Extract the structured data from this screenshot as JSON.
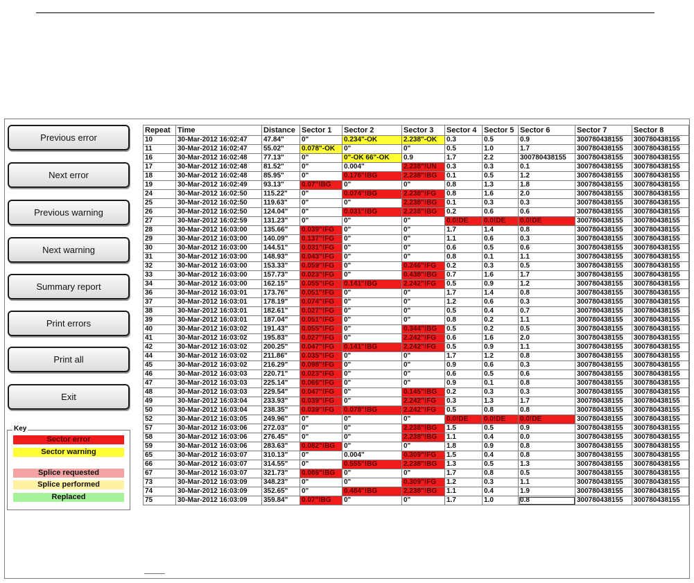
{
  "buttons": [
    {
      "label": "Previous error"
    },
    {
      "label": "Next error"
    },
    {
      "label": "Previous warning"
    },
    {
      "label": "Next warning"
    },
    {
      "label": "Summary report"
    },
    {
      "label": "Print errors"
    },
    {
      "label": "Print all"
    },
    {
      "label": "Exit"
    }
  ],
  "key": {
    "title": "Key",
    "items": [
      {
        "label": "Sector error",
        "color": "#ee1c1c"
      },
      {
        "label": "Sector warning",
        "color": "#ffff33"
      },
      {
        "label": "Splice requested",
        "color": "#f4a3a3"
      },
      {
        "label": "Splice performed",
        "color": "#fff2a3"
      },
      {
        "label": "Replaced",
        "color": "#a6f29a"
      }
    ]
  },
  "table": {
    "headers": [
      "Repeat",
      "Time",
      "Distance",
      "Sector 1",
      "Sector 2",
      "Sector 3",
      "Sector 4",
      "Sector 5",
      "Sector 6",
      "Sector 7",
      "Sector 8"
    ],
    "rows": [
      [
        "10",
        "30-Mar-2012 16:02:47",
        "47.84\"",
        "0\"",
        "0.234\"-OK",
        "2.238\"-OK",
        "0.3",
        "0.5",
        "0.9",
        "300780438155",
        "300780438155"
      ],
      [
        "11",
        "30-Mar-2012 16:02:47",
        "55.02\"",
        "0.078\"-OK",
        "0\"",
        "0\"",
        "0.5",
        "1.0",
        "1.7",
        "300780438155",
        "300780438155"
      ],
      [
        "16",
        "30-Mar-2012 16:02:48",
        "77.13\"",
        "0\"",
        "0\"-OK 66\"-OK",
        "0.9",
        "1.7",
        "2.2",
        "300780438155",
        "300780438155",
        "300780438155"
      ],
      [
        "17",
        "30-Mar-2012 16:02:48",
        "81.52\"",
        "0\"",
        "0.004\"",
        "2.238\"!UN",
        "0.3",
        "0.3",
        "0.1",
        "300780438155",
        "300780438155"
      ],
      [
        "18",
        "30-Mar-2012 16:02:48",
        "85.95\"",
        "0\"",
        "0.176\"!BG",
        "2.238\"!BG",
        "0.1",
        "0.5",
        "1.2",
        "300780438155",
        "300780438155"
      ],
      [
        "19",
        "30-Mar-2012 16:02:49",
        "93.13\"",
        "0.07\"!BG",
        "0\"",
        "0\"",
        "0.8",
        "1.3",
        "1.8",
        "300780438155",
        "300780438155"
      ],
      [
        "24",
        "30-Mar-2012 16:02:50",
        "115.22\"",
        "0\"",
        "0.074\"!BG",
        "2.238\"!FG",
        "0.8",
        "1.6",
        "2.0",
        "300780438155",
        "300780438155"
      ],
      [
        "25",
        "30-Mar-2012 16:02:50",
        "119.63\"",
        "0\"",
        "0\"",
        "2.238\"!BG",
        "0.1",
        "0.3",
        "0.3",
        "300780438155",
        "300780438155"
      ],
      [
        "26",
        "30-Mar-2012 16:02:50",
        "124.04\"",
        "0\"",
        "0.031\"!BG",
        "2.238\"!BG",
        "0.2",
        "0.6",
        "0.6",
        "300780438155",
        "300780438155"
      ],
      [
        "27",
        "30-Mar-2012 16:02:59",
        "131.23\"",
        "0\"",
        "0\"",
        "0\"",
        "0.0!DE",
        "0.0!DE",
        "0.0!DE",
        "300780438155",
        "300780438155"
      ],
      [
        "28",
        "30-Mar-2012 16:03:00",
        "135.66\"",
        "0.039\"!FG",
        "0\"",
        "0\"",
        "1.7",
        "1.4",
        "0.8",
        "300780438155",
        "300780438155"
      ],
      [
        "29",
        "30-Mar-2012 16:03:00",
        "140.09\"",
        "0.137\"!FG",
        "0\"",
        "0\"",
        "1.1",
        "0.6",
        "0.3",
        "300780438155",
        "300780438155"
      ],
      [
        "30",
        "30-Mar-2012 16:03:00",
        "144.51\"",
        "0.031\"!FG",
        "0\"",
        "0\"",
        "0.6",
        "0.5",
        "0.6",
        "300780438155",
        "300780438155"
      ],
      [
        "31",
        "30-Mar-2012 16:03:00",
        "148.93\"",
        "0.043\"!FG",
        "0\"",
        "0\"",
        "0.8",
        "0.1",
        "1.1",
        "300780438155",
        "300780438155"
      ],
      [
        "32",
        "30-Mar-2012 16:03:00",
        "153.33\"",
        "0.059\"!FG",
        "0\"",
        "0.246\"!FG",
        "0.2",
        "0.3",
        "0.5",
        "300780438155",
        "300780438155"
      ],
      [
        "33",
        "30-Mar-2012 16:03:00",
        "157.73\"",
        "0.023\"!FG",
        "0\"",
        "0.438\"!BG",
        "0.7",
        "1.6",
        "1.7",
        "300780438155",
        "300780438155"
      ],
      [
        "34",
        "30-Mar-2012 16:03:00",
        "162.15\"",
        "0.055\"!FG",
        "0.141\"!BG",
        "2.242\"!FG",
        "0.5",
        "0.9",
        "1.2",
        "300780438155",
        "300780438155"
      ],
      [
        "36",
        "30-Mar-2012 16:03:01",
        "173.76\"",
        "0.051\"!FG",
        "0\"",
        "0\"",
        "1.7",
        "1.4",
        "0.8",
        "300780438155",
        "300780438155"
      ],
      [
        "37",
        "30-Mar-2012 16:03:01",
        "178.19\"",
        "0.074\"!FG",
        "0\"",
        "0\"",
        "1.2",
        "0.6",
        "0.3",
        "300780438155",
        "300780438155"
      ],
      [
        "38",
        "30-Mar-2012 16:03:01",
        "182.61\"",
        "0.027\"!FG",
        "0\"",
        "0\"",
        "0.5",
        "0.4",
        "0.7",
        "300780438155",
        "300780438155"
      ],
      [
        "39",
        "30-Mar-2012 16:03:01",
        "187.04\"",
        "0.051\"!FG",
        "0\"",
        "0\"",
        "0.8",
        "0.2",
        "1.1",
        "300780438155",
        "300780438155"
      ],
      [
        "40",
        "30-Mar-2012 16:03:02",
        "191.43\"",
        "0.055\"!FG",
        "0\"",
        "0.344\"!BG",
        "0.5",
        "0.2",
        "0.5",
        "300780438155",
        "300780438155"
      ],
      [
        "41",
        "30-Mar-2012 16:03:02",
        "195.83\"",
        "0.027\"!FG",
        "0\"",
        "2.242\"!FG",
        "0.6",
        "1.6",
        "2.0",
        "300780438155",
        "300780438155"
      ],
      [
        "42",
        "30-Mar-2012 16:03:02",
        "200.25\"",
        "0.047\"!FG",
        "0.141\"!BG",
        "2.242\"!FG",
        "0.5",
        "0.9",
        "1.1",
        "300780438155",
        "300780438155"
      ],
      [
        "44",
        "30-Mar-2012 16:03:02",
        "211.86\"",
        "0.035\"!FG",
        "0\"",
        "0\"",
        "1.7",
        "1.2",
        "0.8",
        "300780438155",
        "300780438155"
      ],
      [
        "45",
        "30-Mar-2012 16:03:02",
        "216.29\"",
        "0.098\"!FG",
        "0\"",
        "0\"",
        "0.9",
        "0.6",
        "0.3",
        "300780438155",
        "300780438155"
      ],
      [
        "46",
        "30-Mar-2012 16:03:03",
        "220.71\"",
        "0.023\"!FG",
        "0\"",
        "0\"",
        "0.6",
        "0.5",
        "0.6",
        "300780438155",
        "300780438155"
      ],
      [
        "47",
        "30-Mar-2012 16:03:03",
        "225.14\"",
        "0.066\"!FG",
        "0\"",
        "0\"",
        "0.9",
        "0.1",
        "0.8",
        "300780438155",
        "300780438155"
      ],
      [
        "48",
        "30-Mar-2012 16:03:03",
        "229.54\"",
        "0.047\"!FG",
        "0\"",
        "0.145\"!BG",
        "0.2",
        "0.3",
        "0.3",
        "300780438155",
        "300780438155"
      ],
      [
        "49",
        "30-Mar-2012 16:03:04",
        "233.93\"",
        "0.039\"!FG",
        "0\"",
        "2.242\"!FG",
        "0.3",
        "1.3",
        "1.7",
        "300780438155",
        "300780438155"
      ],
      [
        "50",
        "30-Mar-2012 16:03:04",
        "238.35\"",
        "0.039\"!FG",
        "0.078\"!BG",
        "2.242\"!FG",
        "0.5",
        "0.8",
        "0.8",
        "300780438155",
        "300780438155"
      ],
      [
        "52",
        "30-Mar-2012 16:03:05",
        "249.96\"",
        "0\"",
        "0\"",
        "0\"",
        "0.0!DE",
        "0.0!DE",
        "0.0!DE",
        "300780438155",
        "300780438155"
      ],
      [
        "57",
        "30-Mar-2012 16:03:06",
        "272.03\"",
        "0\"",
        "0\"",
        "2.238\"!BG",
        "1.5",
        "0.5",
        "0.9",
        "300780438155",
        "300780438155"
      ],
      [
        "58",
        "30-Mar-2012 16:03:06",
        "276.45\"",
        "0\"",
        "0\"",
        "2.238\"!BG",
        "1.1",
        "0.4",
        "0.0",
        "300780438155",
        "300780438155"
      ],
      [
        "59",
        "30-Mar-2012 16:03:06",
        "283.63\"",
        "0.082\"!BG",
        "0\"",
        "0\"",
        "1.8",
        "0.9",
        "0.8",
        "300780438155",
        "300780438155"
      ],
      [
        "65",
        "30-Mar-2012 16:03:07",
        "310.13\"",
        "0\"",
        "0.004\"",
        "0.309\"!FG",
        "1.5",
        "0.4",
        "0.8",
        "300780438155",
        "300780438155"
      ],
      [
        "66",
        "30-Mar-2012 16:03:07",
        "314.55\"",
        "0\"",
        "0.555\"!BG",
        "2.238\"!BG",
        "1.3",
        "0.5",
        "1.3",
        "300780438155",
        "300780438155"
      ],
      [
        "67",
        "30-Mar-2012 16:03:07",
        "321.73\"",
        "0.086\"!BG",
        "0\"",
        "0\"",
        "1.7",
        "0.8",
        "0.5",
        "300780438155",
        "300780438155"
      ],
      [
        "73",
        "30-Mar-2012 16:03:09",
        "348.23\"",
        "0\"",
        "0\"",
        "0.309\"!FG",
        "1.2",
        "0.3",
        "1.1",
        "300780438155",
        "300780438155"
      ],
      [
        "74",
        "30-Mar-2012 16:03:09",
        "352.65\"",
        "0\"",
        "0.484\"!BG",
        "2.238\"!BG",
        "1.1",
        "0.4",
        "1.9",
        "300780438155",
        "300780438155"
      ],
      [
        "75",
        "30-Mar-2012 16:03:09",
        "359.84\"",
        "0.07\"!BG",
        "0\"",
        "0\"",
        "1.7",
        "1.0",
        "0.8",
        "300780438155",
        "300780438155"
      ]
    ],
    "selected_cell": {
      "row": 40,
      "col": 8
    }
  }
}
